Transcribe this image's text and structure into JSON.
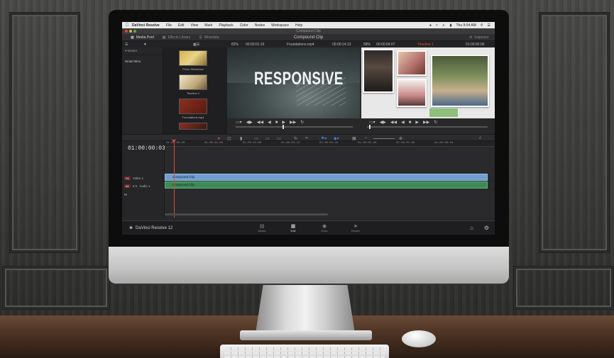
{
  "menubar": {
    "app_name": "DaVinci Resolve",
    "items": [
      "File",
      "Edit",
      "View",
      "Mark",
      "Playback",
      "Color",
      "Nodes",
      "Workspace",
      "Help"
    ],
    "clock": "Thu 9:04 AM"
  },
  "window": {
    "title": "Compound Clip"
  },
  "tabs": {
    "media_pool": "Media Pool",
    "effects_library": "Effects Library",
    "metadata": "Metadata",
    "center_title": "Compound Clip",
    "inspector": "Inspector"
  },
  "viewer_bar": {
    "zoom": "82%",
    "source_tc": "00:00:01:16",
    "source_clip": "Foundations.mp4",
    "source_dur": "00:00:14:13",
    "zoom2": "58%",
    "tc2": "00:00:04:07",
    "timeline_name": "Timeline 1",
    "record_tc": "01:00:00:00"
  },
  "media_pool_panel": {
    "header": "Master",
    "bins": [
      "Smart Bins"
    ]
  },
  "clips": [
    {
      "name": "Photo Slideshow",
      "color": "#c9a64a"
    },
    {
      "name": "Timeline 1",
      "color": "#e6d9b8"
    },
    {
      "name": "Foundations.mp4",
      "color": "#7a2a1c"
    }
  ],
  "viewer": {
    "headline": "RESPONSIVE"
  },
  "timeline": {
    "timecode": "01:00:00:03",
    "ruler_ticks": [
      "01:00:00:00",
      "01:00:01:04",
      "01:00:02:08",
      "01:00:03:12",
      "01:00:04:16",
      "01:00:05:20",
      "01:00:07:00",
      "01:00:08:04"
    ],
    "tracks": [
      {
        "id": "V1",
        "label": "Video 1"
      },
      {
        "id": "A1",
        "label": "Audio 1",
        "level": "2.0"
      },
      {
        "id": "M",
        "label": ""
      }
    ],
    "video_clip": "Compound Clip",
    "audio_clip": "Compound Clip"
  },
  "pages": [
    {
      "label": "Media",
      "icon": "media-icon"
    },
    {
      "label": "Edit",
      "icon": "edit-icon",
      "active": true
    },
    {
      "label": "Color",
      "icon": "color-icon"
    },
    {
      "label": "Deliver",
      "icon": "deliver-icon"
    }
  ],
  "brand": {
    "name": "DaVinci Resolve 12"
  },
  "colors": {
    "accent_red": "#e0463c",
    "video_clip": "#6f9fcf",
    "audio_clip": "#3d8a57"
  }
}
